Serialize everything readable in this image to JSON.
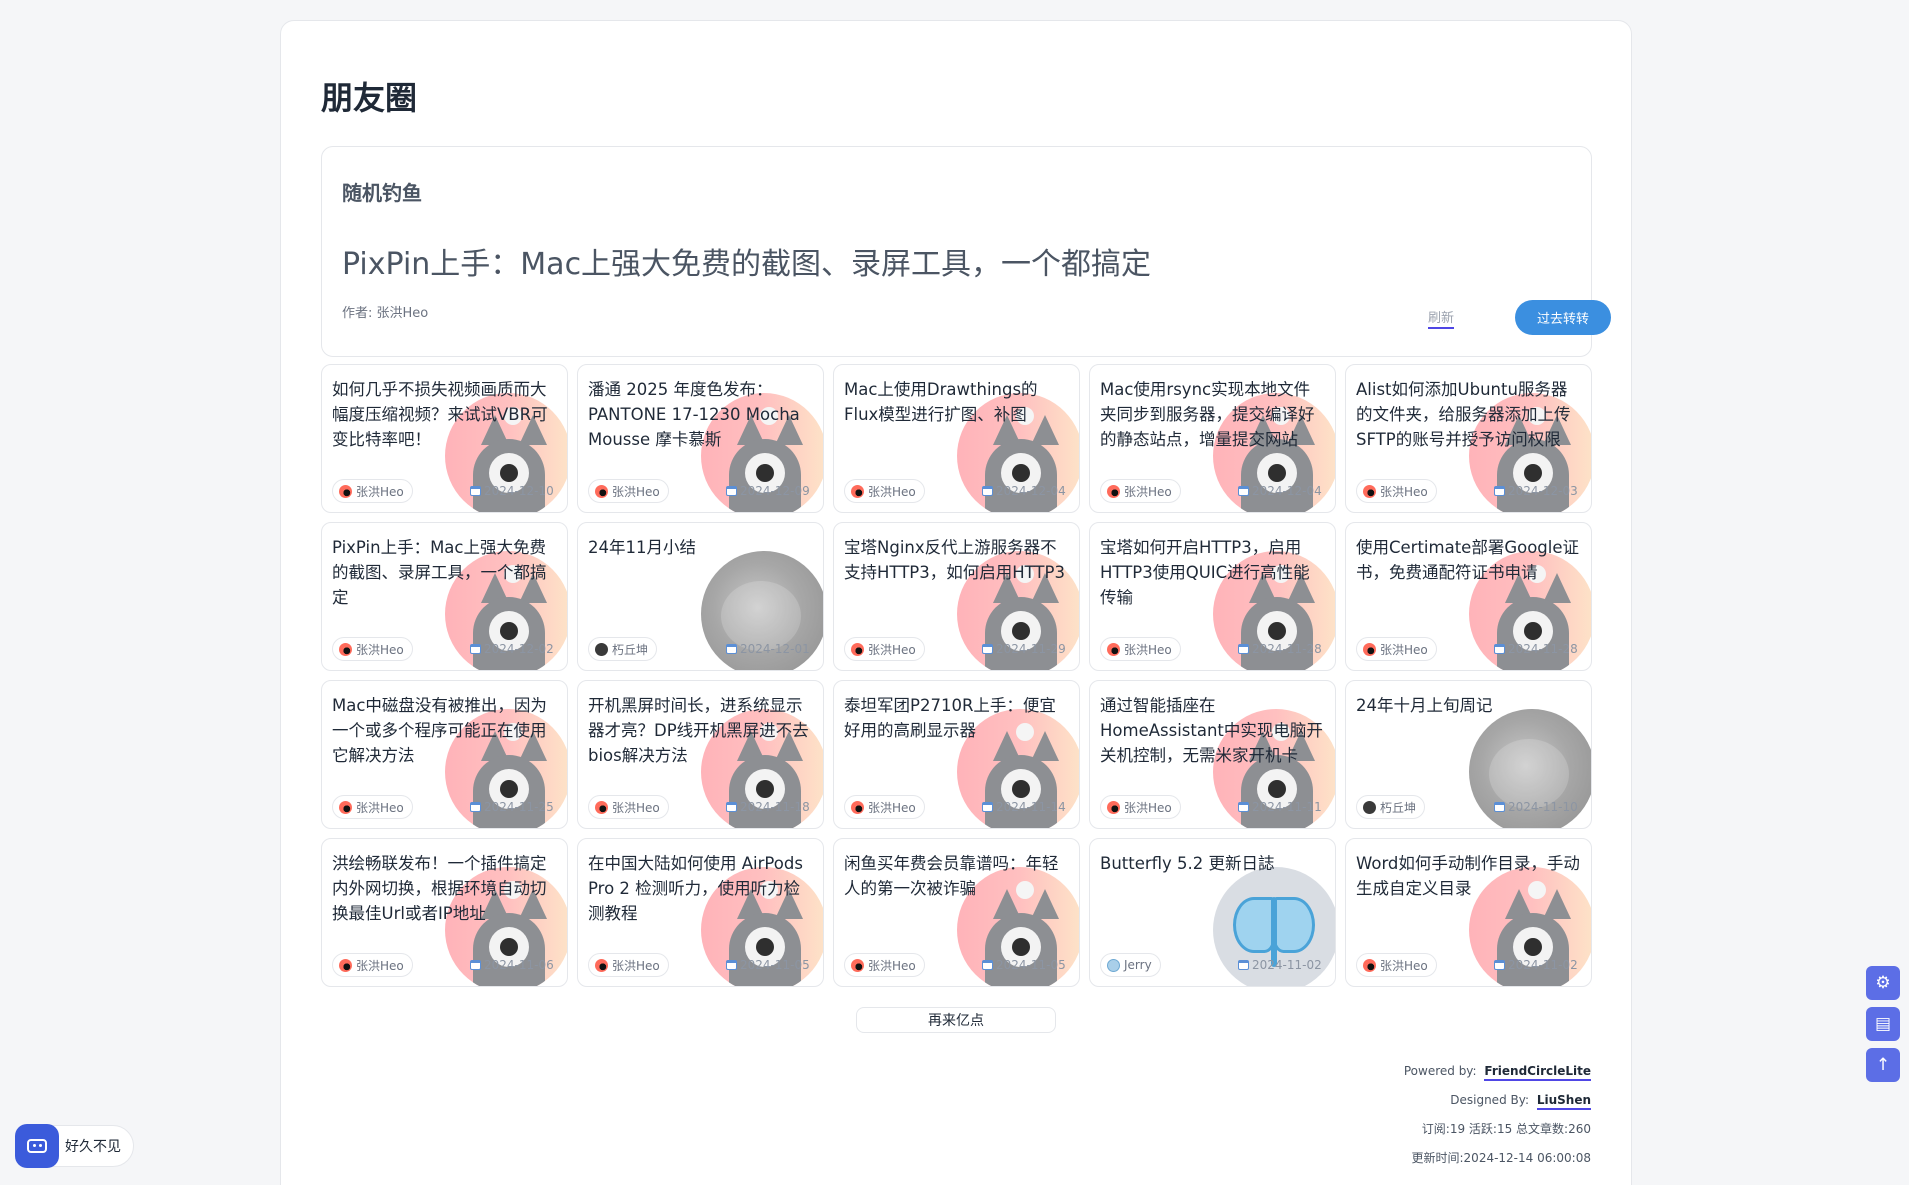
{
  "page": {
    "title": "朋友圈"
  },
  "random": {
    "label": "随机钓鱼",
    "title": "PixPin上手：Mac上强大免费的截图、录屏工具，一个都搞定",
    "author": "作者: 张洪Heo",
    "refresh_label": "刷新",
    "go_label": "过去转转"
  },
  "articles": [
    {
      "title": "如何几乎不损失视频画质而大幅度压缩视频？来试试VBR可变比特率吧！",
      "author": "张洪Heo",
      "date": "2024-12-10",
      "avatar": "heo"
    },
    {
      "title": "潘通 2025 年度色发布：PANTONE 17-1230 Mocha Mousse 摩卡慕斯",
      "author": "张洪Heo",
      "date": "2024-12-09",
      "avatar": "heo"
    },
    {
      "title": "Mac上使用Drawthings的Flux模型进行扩图、补图",
      "author": "张洪Heo",
      "date": "2024-12-04",
      "avatar": "heo"
    },
    {
      "title": "Mac使用rsync实现本地文件夹同步到服务器，提交编译好的静态站点，增量提交网站",
      "author": "张洪Heo",
      "date": "2024-12-04",
      "avatar": "heo"
    },
    {
      "title": "Alist如何添加Ubuntu服务器的文件夹，给服务器添加上传SFTP的账号并授予访问权限",
      "author": "张洪Heo",
      "date": "2024-12-03",
      "avatar": "heo"
    },
    {
      "title": "PixPin上手：Mac上强大免费的截图、录屏工具，一个都搞定",
      "author": "张洪Heo",
      "date": "2024-12-02",
      "avatar": "heo"
    },
    {
      "title": "24年11月小结",
      "author": "朽丘坤",
      "date": "2024-12-01",
      "avatar": "rat"
    },
    {
      "title": "宝塔Nginx反代上游服务器不支持HTTP3，如何启用HTTP3",
      "author": "张洪Heo",
      "date": "2024-11-29",
      "avatar": "heo"
    },
    {
      "title": "宝塔如何开启HTTP3，启用HTTP3使用QUIC进行高性能传输",
      "author": "张洪Heo",
      "date": "2024-11-28",
      "avatar": "heo"
    },
    {
      "title": "使用Certimate部署Google证书，免费通配符证书申请",
      "author": "张洪Heo",
      "date": "2024-11-28",
      "avatar": "heo"
    },
    {
      "title": "Mac中磁盘没有被推出，因为一个或多个程序可能正在使用它解决方法",
      "author": "张洪Heo",
      "date": "2024-11-25",
      "avatar": "heo"
    },
    {
      "title": "开机黑屏时间长，进系统显示器才亮？DP线开机黑屏进不去bios解决方法",
      "author": "张洪Heo",
      "date": "2024-11-18",
      "avatar": "heo"
    },
    {
      "title": "泰坦军团P2710R上手：便宜好用的高刷显示器",
      "author": "张洪Heo",
      "date": "2024-11-14",
      "avatar": "heo"
    },
    {
      "title": "通过智能插座在HomeAssistant中实现电脑开关机控制，无需米家开机卡",
      "author": "张洪Heo",
      "date": "2024-11-11",
      "avatar": "heo"
    },
    {
      "title": "24年十月上旬周记",
      "author": "朽丘坤",
      "date": "2024-11-10",
      "avatar": "rat"
    },
    {
      "title": "洪绘畅联发布！一个插件搞定内外网切换，根据环境自动切换最佳Url或者IP地址",
      "author": "张洪Heo",
      "date": "2024-11-06",
      "avatar": "heo"
    },
    {
      "title": "在中国大陆如何使用 AirPods Pro 2 检测听力，使用听力检测教程",
      "author": "张洪Heo",
      "date": "2024-11-05",
      "avatar": "heo"
    },
    {
      "title": "闲鱼买年费会员靠谱吗：年轻人的第一次被诈骗",
      "author": "张洪Heo",
      "date": "2024-11-05",
      "avatar": "heo"
    },
    {
      "title": "Butterfly 5.2 更新日誌",
      "author": "Jerry",
      "date": "2024-11-02",
      "avatar": "jerry"
    },
    {
      "title": "Word如何手动制作目录，手动生成自定义目录",
      "author": "张洪Heo",
      "date": "2024-11-02",
      "avatar": "heo"
    }
  ],
  "load_more_label": "再来亿点",
  "footer": {
    "powered_label": "Powered by:",
    "powered_link": "FriendCircleLite",
    "designed_label": "Designed By:",
    "designed_link": "LiuShen",
    "stats": "订阅:19 活跃:15 总文章数:260",
    "updated": "更新时间:2024-12-14 06:00:08"
  },
  "side_tools": {
    "settings_icon": "gear-icon",
    "reading_icon": "document-icon",
    "top_icon": "arrow-up-icon",
    "color": "#5c6ee6"
  },
  "chat": {
    "label": "好久不见"
  }
}
